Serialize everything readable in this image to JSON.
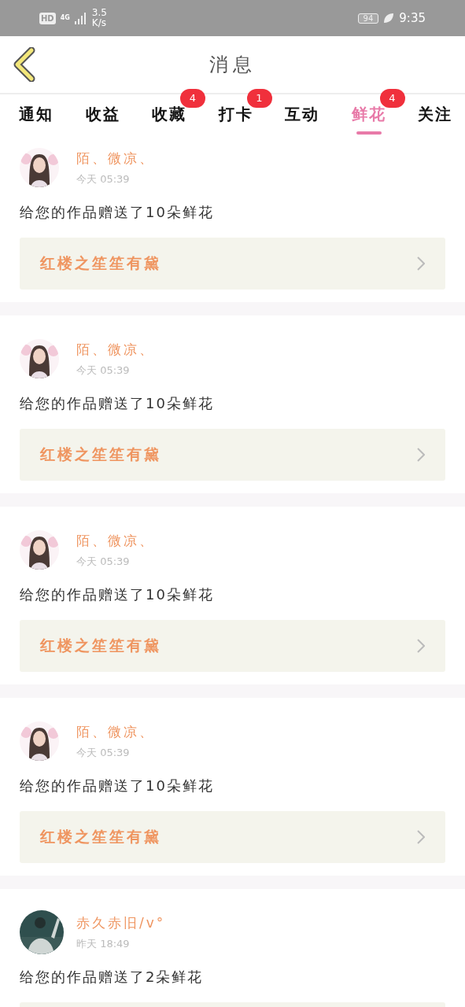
{
  "status_bar": {
    "hd": "HD",
    "speed_value": "3.5",
    "speed_unit": "K/s",
    "network": "4G",
    "battery": "94",
    "time": "9:35"
  },
  "header": {
    "title": "消息"
  },
  "tabs": [
    {
      "label": "通知",
      "selected": false
    },
    {
      "label": "收益",
      "selected": false
    },
    {
      "label": "收藏",
      "selected": false,
      "badge": "4"
    },
    {
      "label": "打卡",
      "selected": false,
      "badge": "1"
    },
    {
      "label": "互动",
      "selected": false
    },
    {
      "label": "鲜花",
      "selected": true,
      "badge": "4"
    },
    {
      "label": "关注",
      "selected": false
    }
  ],
  "messages": [
    {
      "sender": "陌、微凉、",
      "day": "今天",
      "time": "05:39",
      "text": "给您的作品赠送了10朵鲜花",
      "work": "红楼之笙笙有黛"
    },
    {
      "sender": "陌、微凉、",
      "day": "今天",
      "time": "05:39",
      "text": "给您的作品赠送了10朵鲜花",
      "work": "红楼之笙笙有黛"
    },
    {
      "sender": "陌、微凉、",
      "day": "今天",
      "time": "05:39",
      "text": "给您的作品赠送了10朵鲜花",
      "work": "红楼之笙笙有黛"
    },
    {
      "sender": "陌、微凉、",
      "day": "今天",
      "time": "05:39",
      "text": "给您的作品赠送了10朵鲜花",
      "work": "红楼之笙笙有黛"
    },
    {
      "sender": "赤久赤旧/v°",
      "day": "昨天",
      "time": "18:49",
      "text": "给您的作品赠送了2朵鲜花"
    }
  ]
}
